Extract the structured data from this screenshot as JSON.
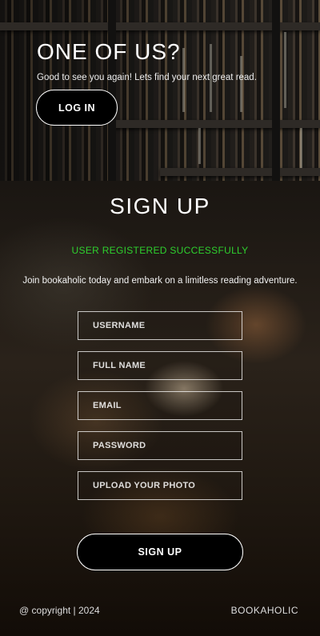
{
  "hero": {
    "title": "ONE OF US?",
    "subtitle": "Good to see you again! Lets find your next great read.",
    "login_label": "LOG IN"
  },
  "signup": {
    "title": "SIGN UP",
    "status": "USER REGISTERED SUCCESSFULLY",
    "status_color": "#2ed12e",
    "intro": "Join bookaholic today and embark on a limitless reading adventure.",
    "fields": {
      "username_placeholder": "USERNAME",
      "fullname_placeholder": "FULL NAME",
      "email_placeholder": "EMAIL",
      "password_placeholder": "PASSWORD",
      "upload_label": "UPLOAD YOUR PHOTO"
    },
    "submit_label": "SIGN UP"
  },
  "footer": {
    "copyright": "@ copyright | 2024",
    "brand": "BOOKAHOLIC"
  }
}
